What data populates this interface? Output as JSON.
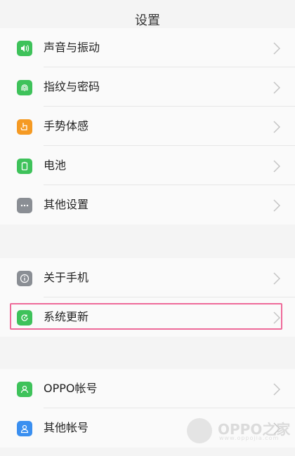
{
  "header": {
    "title": "设置"
  },
  "section1": [
    {
      "label": "声音与振动",
      "icon": "sound-icon",
      "color": "#3ec25a"
    },
    {
      "label": "指纹与密码",
      "icon": "fingerprint-icon",
      "color": "#3ec25a"
    },
    {
      "label": "手势体感",
      "icon": "gesture-icon",
      "color": "#f59a23"
    },
    {
      "label": "电池",
      "icon": "battery-icon",
      "color": "#3ec25a"
    },
    {
      "label": "其他设置",
      "icon": "more-icon",
      "color": "#8a8e94"
    }
  ],
  "section2": [
    {
      "label": "关于手机",
      "icon": "info-icon",
      "color": "#8a8e94"
    },
    {
      "label": "系统更新",
      "icon": "update-icon",
      "color": "#3ec25a",
      "highlighted": true
    }
  ],
  "section3": [
    {
      "label": "OPPO帐号",
      "icon": "account-icon",
      "color": "#3ec25a"
    },
    {
      "label": "其他帐号",
      "icon": "accounts-icon",
      "color": "#3a8ff0"
    }
  ],
  "watermark": {
    "text": "OPPO之家",
    "url": "www.oppojia.com"
  }
}
